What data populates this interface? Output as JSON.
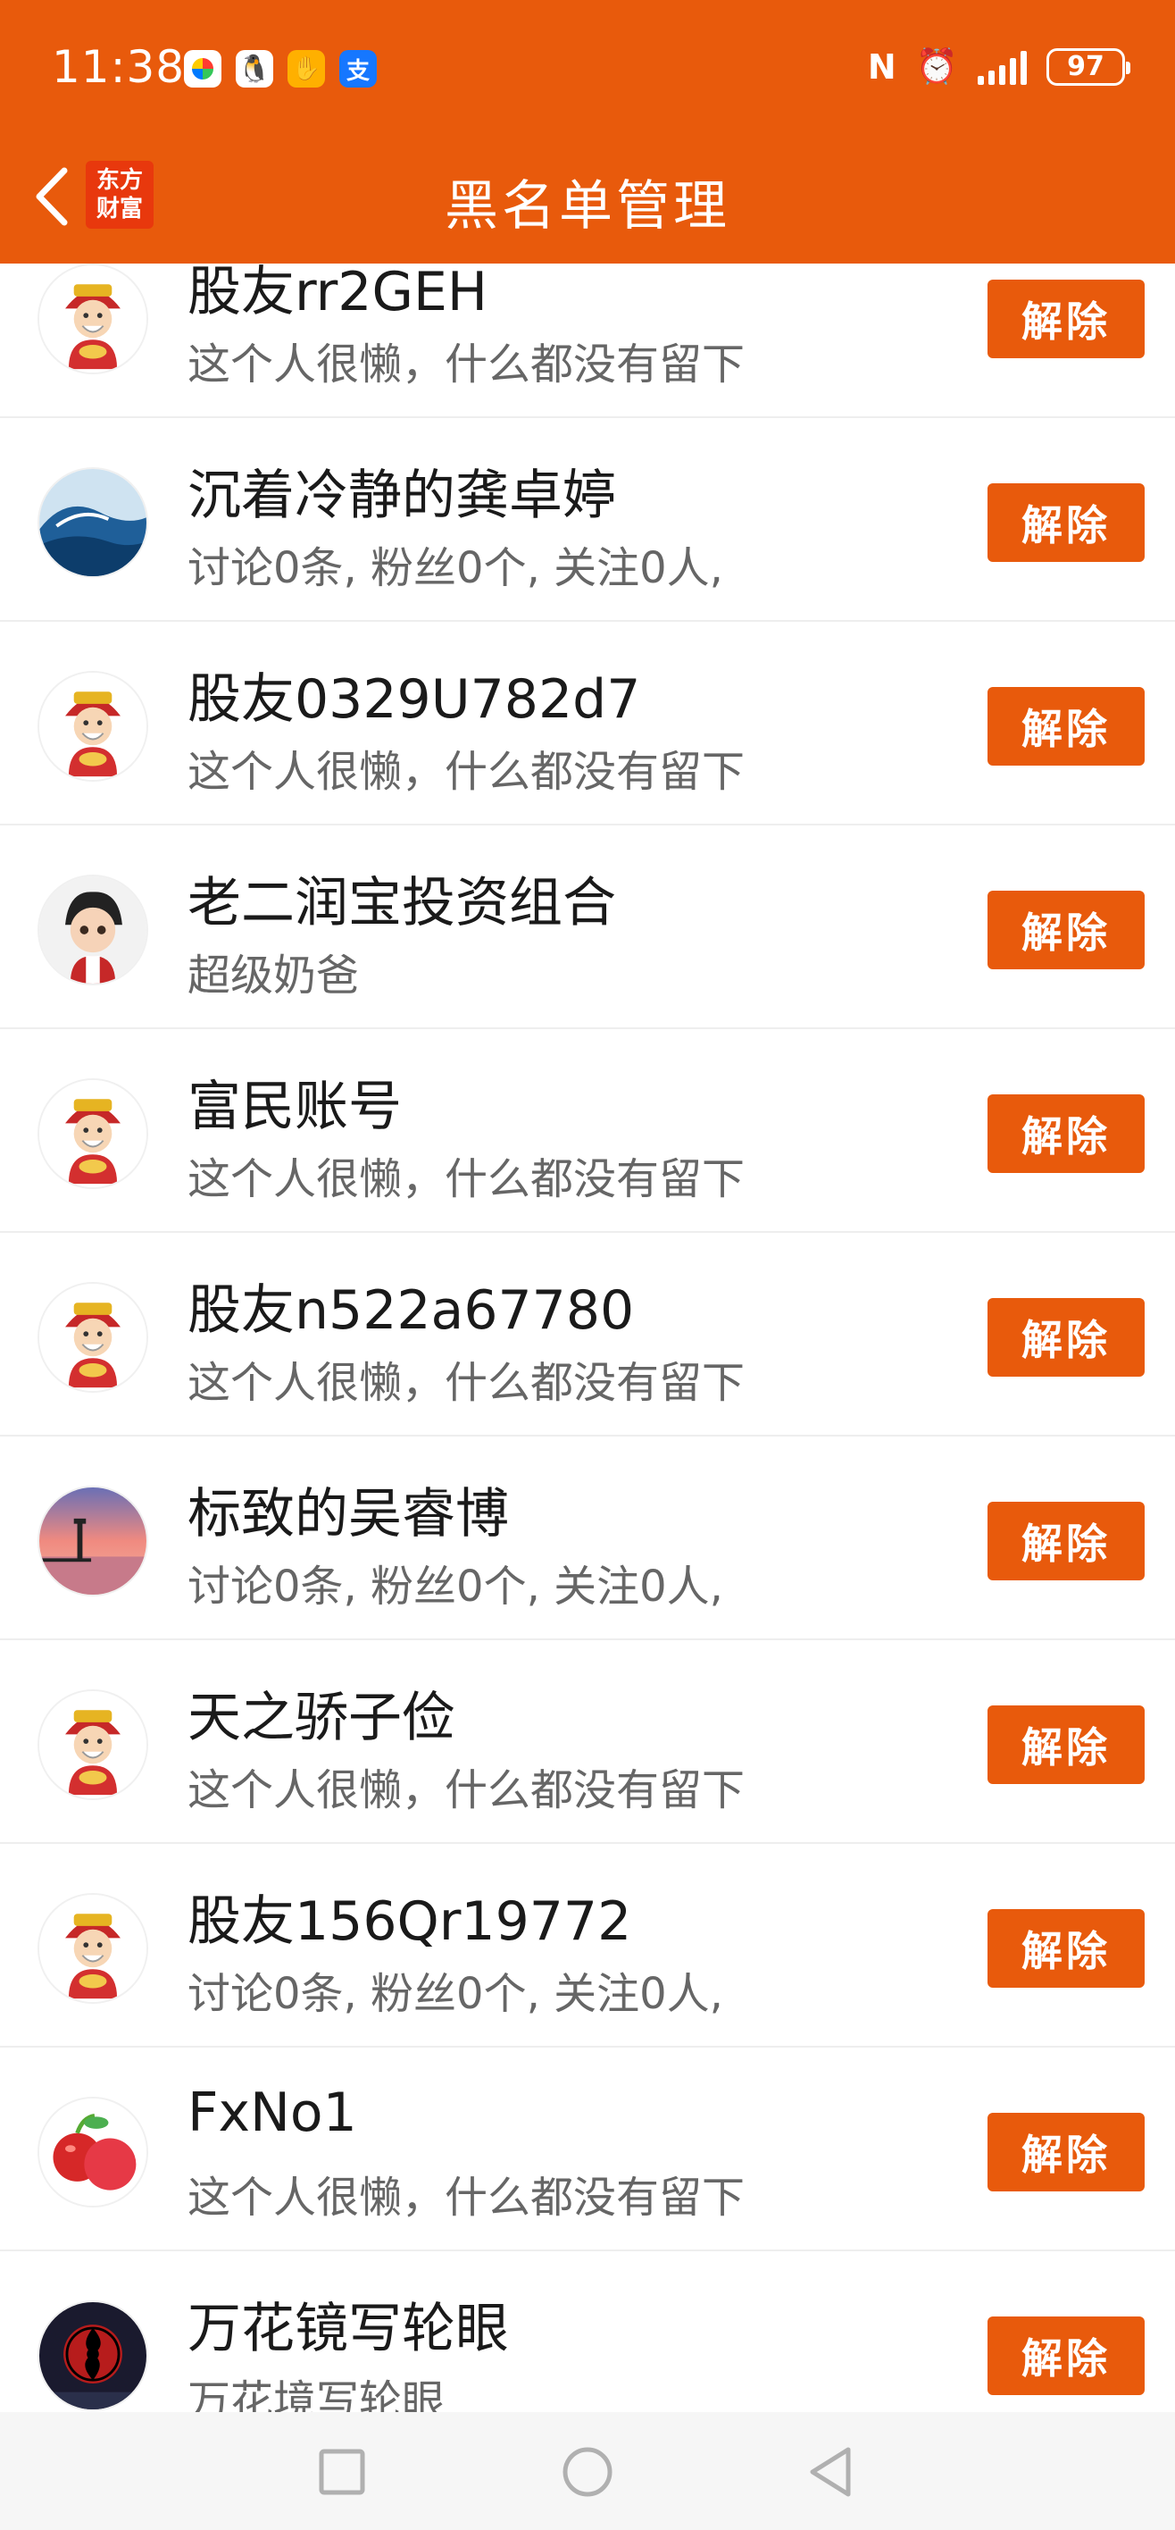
{
  "status_bar": {
    "time": "11:38",
    "app_icons": [
      "color-app-icon",
      "qq-icon",
      "orange-app-icon",
      "alipay-icon"
    ],
    "app4_glyph": "支",
    "battery": "97",
    "icons": [
      "nfc-icon",
      "alarm-icon",
      "signal-icon",
      "battery-icon"
    ]
  },
  "header": {
    "logo_text_line1": "东方",
    "logo_text_line2": "财富",
    "title": "黑名单管理",
    "background": "#e85a0c"
  },
  "unblock_label": "解除",
  "rows": [
    {
      "name": "股友rr2GEH",
      "desc": "这个人很懒，什么都没有留下",
      "avatar": "caishen"
    },
    {
      "name": "沉着冷静的龚卓婷",
      "desc": "讨论0条, 粉丝0个, 关注0人,",
      "avatar": "wave"
    },
    {
      "name": "股友0329U782d7",
      "desc": "这个人很懒，什么都没有留下",
      "avatar": "caishen"
    },
    {
      "name": "老二润宝投资组合",
      "desc": "超级奶爸",
      "avatar": "boy"
    },
    {
      "name": "富民账号",
      "desc": "这个人很懒，什么都没有留下",
      "avatar": "caishen"
    },
    {
      "name": "股友n522a67780",
      "desc": "这个人很懒，什么都没有留下",
      "avatar": "caishen"
    },
    {
      "name": "标致的吴睿博",
      "desc": "讨论0条, 粉丝0个, 关注0人,",
      "avatar": "sunset"
    },
    {
      "name": "天之骄子俭",
      "desc": "这个人很懒，什么都没有留下",
      "avatar": "caishen"
    },
    {
      "name": "股友156Qr19772",
      "desc": "讨论0条, 粉丝0个, 关注0人,",
      "avatar": "caishen"
    },
    {
      "name": "FxNo1",
      "desc": "这个人很懒，什么都没有留下",
      "avatar": "apple"
    },
    {
      "name": "万花镜写轮眼",
      "desc": "万花境写轮眼",
      "avatar": "sharingan"
    }
  ],
  "nav": {
    "icons": [
      "recent-apps-icon",
      "home-icon",
      "back-triangle-icon"
    ]
  }
}
